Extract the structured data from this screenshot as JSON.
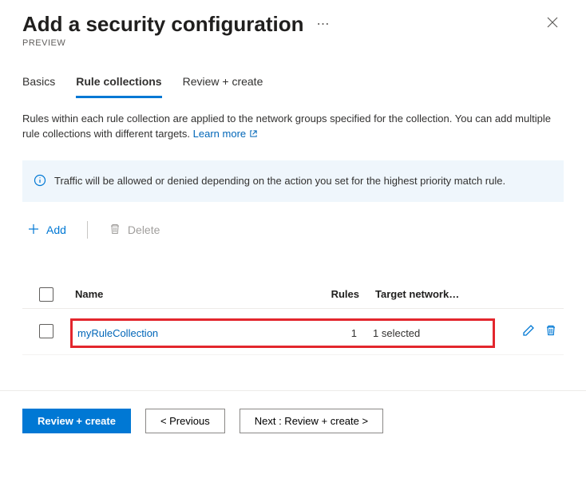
{
  "header": {
    "title": "Add a security configuration",
    "subtitle": "PREVIEW"
  },
  "tabs": {
    "basics": "Basics",
    "rule_collections": "Rule collections",
    "review_create": "Review + create"
  },
  "description": {
    "text": "Rules within each rule collection are applied to the network groups specified for the collection. You can add multiple rule collections with different targets. ",
    "learn_more": "Learn more"
  },
  "infobox": {
    "text": "Traffic will be allowed or denied depending on the action you set for the highest priority match rule."
  },
  "toolbar": {
    "add_label": "Add",
    "delete_label": "Delete"
  },
  "table": {
    "columns": {
      "name": "Name",
      "rules": "Rules",
      "target": "Target network…"
    },
    "rows": [
      {
        "name": "myRuleCollection",
        "rules": "1",
        "target": "1 selected"
      }
    ]
  },
  "footer": {
    "review_create": "Review + create",
    "previous": "< Previous",
    "next": "Next : Review + create >"
  }
}
